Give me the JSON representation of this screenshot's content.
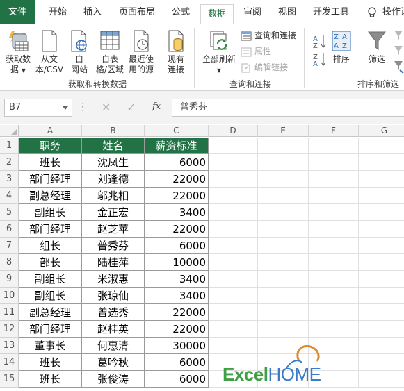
{
  "colors": {
    "accent": "#217346",
    "header_fill": "#217346",
    "header_text": "#ffffff",
    "watermark_green": "#3ea043",
    "watermark_blue": "#3a7cc8"
  },
  "ribbon_tabs": [
    "文件",
    "开始",
    "插入",
    "页面布局",
    "公式",
    "数据",
    "审阅",
    "视图",
    "开发工具",
    "操作说"
  ],
  "active_tab": "数据",
  "ribbon": {
    "get_data_l1": "获取数",
    "get_data_l2": "据",
    "from_text_l1": "从文",
    "from_text_l2": "本/CSV",
    "from_web_l1": "自",
    "from_web_l2": "网站",
    "from_table_l1": "自表",
    "from_table_l2": "格/区域",
    "recent_l1": "最近使",
    "recent_l2": "用的源",
    "existing_l1": "现有",
    "existing_l2": "连接",
    "group_get": "获取和转换数据",
    "refresh_all_l1": "全部刷新",
    "queries": "查询和连接",
    "properties": "属性",
    "edit_links": "编辑链接",
    "group_queries": "查询和连接",
    "sort": "排序",
    "filter": "筛选",
    "group_sort": "排序和筛选"
  },
  "formula_bar": {
    "name_box": "B7",
    "formula": "普秀芬",
    "fx": "fx"
  },
  "columns": [
    "A",
    "B",
    "C",
    "D",
    "E",
    "F",
    "G"
  ],
  "rows": [
    "1",
    "2",
    "3",
    "4",
    "5",
    "6",
    "7",
    "8",
    "9",
    "10",
    "11",
    "12",
    "13",
    "14",
    "15"
  ],
  "table": {
    "headers": [
      "职务",
      "姓名",
      "薪资标准"
    ],
    "rows": [
      [
        "班长",
        "沈凤生",
        "6000"
      ],
      [
        "部门经理",
        "刘逢德",
        "22000"
      ],
      [
        "副总经理",
        "邬兆相",
        "22000"
      ],
      [
        "副组长",
        "金正宏",
        "3400"
      ],
      [
        "部门经理",
        "赵芝苹",
        "22000"
      ],
      [
        "组长",
        "普秀芬",
        "6000"
      ],
      [
        "部长",
        "陆桂萍",
        "10000"
      ],
      [
        "副组长",
        "米淑惠",
        "3400"
      ],
      [
        "副组长",
        "张琼仙",
        "3400"
      ],
      [
        "副总经理",
        "曾选秀",
        "22000"
      ],
      [
        "部门经理",
        "赵桂英",
        "22000"
      ],
      [
        "董事长",
        "何惠清",
        "30000"
      ],
      [
        "班长",
        "葛吟秋",
        "6000"
      ],
      [
        "班长",
        "张俊涛",
        "6000"
      ]
    ]
  },
  "watermark": {
    "excel": "Excel",
    "home": "HOME"
  }
}
